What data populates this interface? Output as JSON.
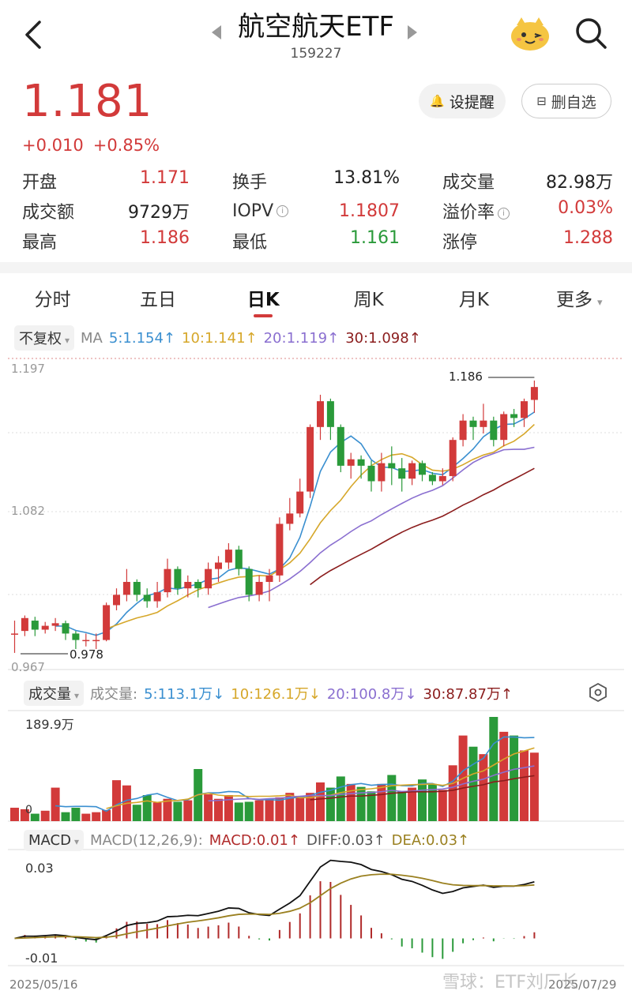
{
  "header": {
    "title": "航空航天ETF",
    "code": "159227"
  },
  "quote": {
    "price": "1.181",
    "change_abs": "+0.010",
    "change_pct": "+0.85%",
    "alert_button": "设提醒",
    "fav_button": "删自选"
  },
  "stats": [
    [
      {
        "label": "开盘",
        "value": "1.171",
        "tone": "red"
      },
      {
        "label": "换手",
        "value": "13.81%",
        "tone": "black"
      },
      {
        "label": "成交量",
        "value": "82.98万",
        "tone": "black"
      }
    ],
    [
      {
        "label": "成交额",
        "value": "9729万",
        "tone": "black"
      },
      {
        "label": "IOPV",
        "value": "1.1807",
        "tone": "red",
        "info": true
      },
      {
        "label": "溢价率",
        "value": "0.03%",
        "tone": "red",
        "info": true
      }
    ],
    [
      {
        "label": "最高",
        "value": "1.186",
        "tone": "red"
      },
      {
        "label": "最低",
        "value": "1.161",
        "tone": "green"
      },
      {
        "label": "涨停",
        "value": "1.288",
        "tone": "red"
      }
    ]
  ],
  "tabs": [
    "分时",
    "五日",
    "日K",
    "周K",
    "月K",
    "更多"
  ],
  "active_tab": "日K",
  "ma_bar": {
    "adjust": "不复权",
    "prefix": "MA",
    "items": [
      {
        "text": "5:1.154↑",
        "color": "#3a8fd0"
      },
      {
        "text": "10:1.141↑",
        "color": "#d6a72a"
      },
      {
        "text": "20:1.119↑",
        "color": "#8a6fd0"
      },
      {
        "text": "30:1.098↑",
        "color": "#8b1d1d"
      }
    ]
  },
  "price_axis": {
    "top": "1.197",
    "mid": "1.082",
    "bottom": "0.967"
  },
  "annotations": {
    "high": "1.186",
    "low": "0.978"
  },
  "vol_bar": {
    "selector": "成交量",
    "prefix": "成交量:",
    "items": [
      {
        "text": "5:113.1万↓",
        "color": "#3a8fd0"
      },
      {
        "text": "10:126.1万↓",
        "color": "#d6a72a"
      },
      {
        "text": "20:100.8万↓",
        "color": "#8a6fd0"
      },
      {
        "text": "30:87.87万↑",
        "color": "#8b1d1d"
      }
    ],
    "max_label": "189.9万",
    "zero_label": "0"
  },
  "macd_bar": {
    "selector": "MACD",
    "params": "MACD(12,26,9):",
    "items": [
      {
        "text": "MACD:0.01↑",
        "color": "#b02a2a"
      },
      {
        "text": "DIFF:0.03↑",
        "color": "#555555"
      },
      {
        "text": "DEA:0.03↑",
        "color": "#9a8020"
      }
    ],
    "top_label": "0.03",
    "bottom_label": "-0.01"
  },
  "dates": {
    "start": "2025/05/16",
    "end": "2025/07/29"
  },
  "watermark": "雪球：ETF刘厂长",
  "colors": {
    "up": "#d23a3a",
    "down": "#2a9a3a"
  },
  "chart_data": {
    "type": "candlestick",
    "candles": [
      [
        0.99,
        0.99,
        1.0,
        0.975
      ],
      [
        0.992,
        1.002,
        1.004,
        0.988
      ],
      [
        1.0,
        0.993,
        1.003,
        0.988
      ],
      [
        0.993,
        0.996,
        0.999,
        0.99
      ],
      [
        0.996,
        0.998,
        1.002,
        0.992
      ],
      [
        0.998,
        0.99,
        1.0,
        0.985
      ],
      [
        0.99,
        0.985,
        0.992,
        0.978
      ],
      [
        0.985,
        0.985,
        0.99,
        0.98
      ],
      [
        0.985,
        0.985,
        0.99,
        0.978
      ],
      [
        0.985,
        1.012,
        1.014,
        0.984
      ],
      [
        1.012,
        1.02,
        1.025,
        1.008
      ],
      [
        1.02,
        1.03,
        1.04,
        1.015
      ],
      [
        1.03,
        1.02,
        1.032,
        1.015
      ],
      [
        1.02,
        1.015,
        1.025,
        1.01
      ],
      [
        1.015,
        1.022,
        1.03,
        1.01
      ],
      [
        1.022,
        1.04,
        1.048,
        1.018
      ],
      [
        1.04,
        1.025,
        1.042,
        1.02
      ],
      [
        1.025,
        1.03,
        1.035,
        1.018
      ],
      [
        1.03,
        1.025,
        1.032,
        1.018
      ],
      [
        1.025,
        1.04,
        1.045,
        1.02
      ],
      [
        1.04,
        1.045,
        1.05,
        1.03
      ],
      [
        1.045,
        1.055,
        1.06,
        1.04
      ],
      [
        1.055,
        1.04,
        1.058,
        1.035
      ],
      [
        1.04,
        1.02,
        1.042,
        1.015
      ],
      [
        1.02,
        1.03,
        1.035,
        1.015
      ],
      [
        1.03,
        1.035,
        1.04,
        1.015
      ],
      [
        1.035,
        1.075,
        1.08,
        1.03
      ],
      [
        1.075,
        1.083,
        1.095,
        1.07
      ],
      [
        1.083,
        1.1,
        1.11,
        1.08
      ],
      [
        1.1,
        1.15,
        1.152,
        1.095
      ],
      [
        1.15,
        1.17,
        1.175,
        1.14
      ],
      [
        1.17,
        1.15,
        1.172,
        1.14
      ],
      [
        1.15,
        1.12,
        1.152,
        1.115
      ],
      [
        1.12,
        1.125,
        1.13,
        1.11
      ],
      [
        1.125,
        1.12,
        1.128,
        1.11
      ],
      [
        1.12,
        1.108,
        1.124,
        1.1
      ],
      [
        1.108,
        1.122,
        1.13,
        1.1
      ],
      [
        1.122,
        1.118,
        1.135,
        1.105
      ],
      [
        1.118,
        1.11,
        1.126,
        1.1
      ],
      [
        1.11,
        1.122,
        1.124,
        1.105
      ],
      [
        1.122,
        1.113,
        1.124,
        1.108
      ],
      [
        1.113,
        1.108,
        1.115,
        1.105
      ],
      [
        1.108,
        1.112,
        1.118,
        1.105
      ],
      [
        1.112,
        1.14,
        1.142,
        1.108
      ],
      [
        1.14,
        1.155,
        1.16,
        1.135
      ],
      [
        1.155,
        1.15,
        1.158,
        1.14
      ],
      [
        1.15,
        1.155,
        1.168,
        1.145
      ],
      [
        1.155,
        1.14,
        1.158,
        1.135
      ],
      [
        1.14,
        1.16,
        1.162,
        1.135
      ],
      [
        1.16,
        1.157,
        1.164,
        1.15
      ],
      [
        1.157,
        1.17,
        1.172,
        1.15
      ],
      [
        1.171,
        1.181,
        1.186,
        1.161
      ]
    ],
    "volume": [
      18,
      16,
      10,
      14,
      45,
      12,
      18,
      10,
      12,
      15,
      55,
      48,
      22,
      35,
      25,
      30,
      26,
      28,
      70,
      36,
      30,
      35,
      25,
      26,
      28,
      30,
      32,
      38,
      34,
      38,
      52,
      45,
      60,
      50,
      46,
      40,
      50,
      62,
      40,
      45,
      56,
      50,
      42,
      75,
      115,
      100,
      90,
      140,
      120,
      115,
      95,
      92
    ]
  }
}
